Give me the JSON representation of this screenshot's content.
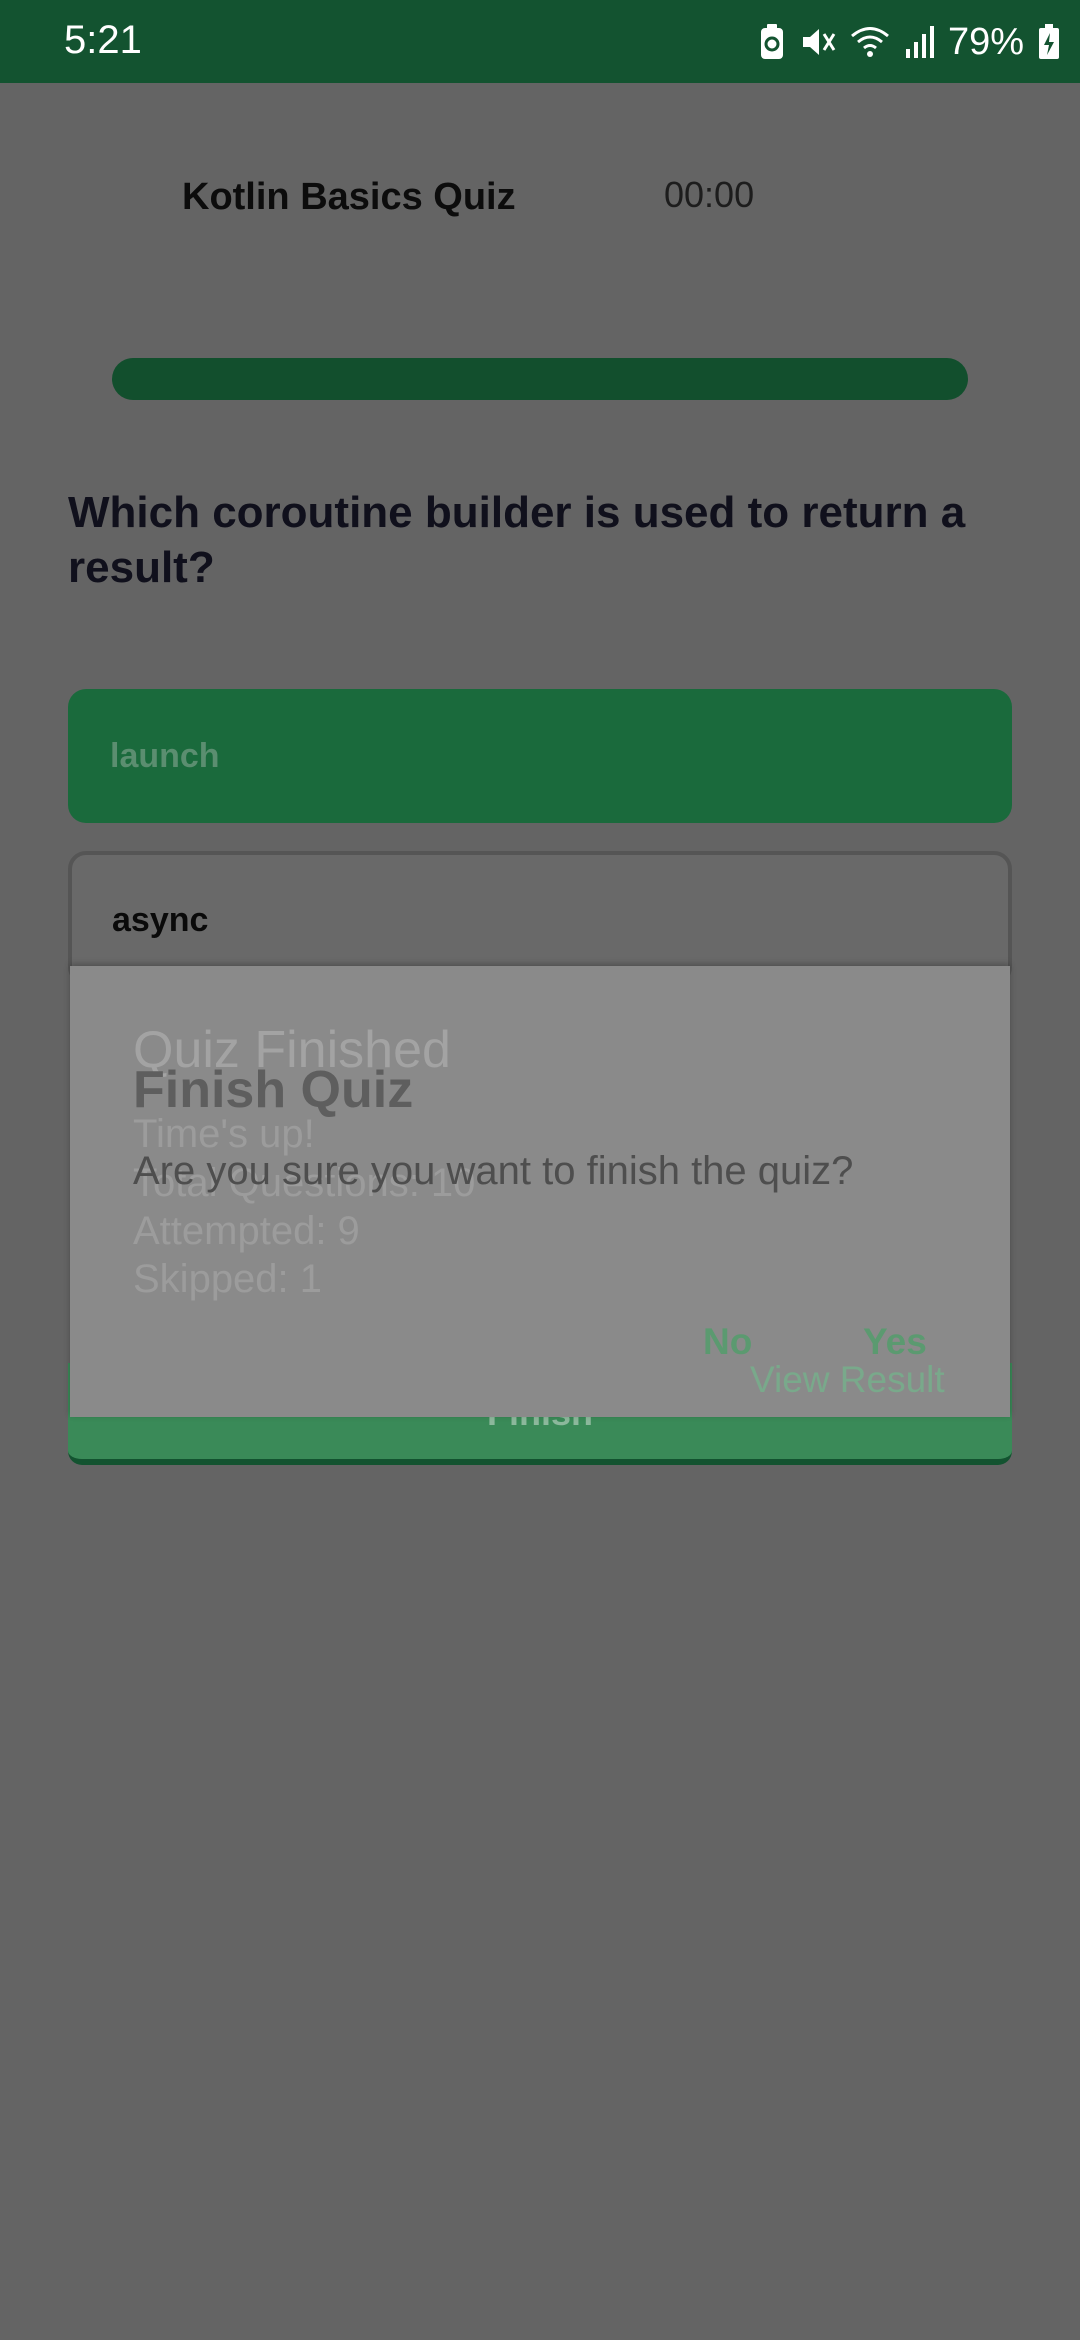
{
  "status_bar": {
    "time": "5:21",
    "battery_percent": "79%",
    "icons": [
      "battery-saver-icon",
      "mute-icon",
      "wifi-icon",
      "signal-icon",
      "battery-charging-icon"
    ]
  },
  "header": {
    "title": "Kotlin Basics Quiz",
    "timer": "00:00"
  },
  "progress": {
    "value": 1.0
  },
  "question": {
    "text": "Which coroutine builder is used to return a result?",
    "options": [
      "launch",
      "async"
    ],
    "selected_index": 0
  },
  "finish_button": {
    "label": "Finish"
  },
  "result_dialog": {
    "title": "Quiz Finished",
    "message": "Time's up!",
    "total": "Total Questions: 10",
    "attempted": "Attempted: 9",
    "skipped": "Skipped: 1",
    "action": "View Result"
  },
  "confirm_dialog": {
    "title": "Finish Quiz",
    "message": "Are you sure you want to finish the quiz?",
    "negative": "No",
    "positive": "Yes"
  },
  "colors": {
    "status_bar": "#135330",
    "accent": "#1a6a3c",
    "scrim_background": "#646464",
    "dialog_surface": "#8a8a8a",
    "dialog_button": "#5b9a70"
  }
}
